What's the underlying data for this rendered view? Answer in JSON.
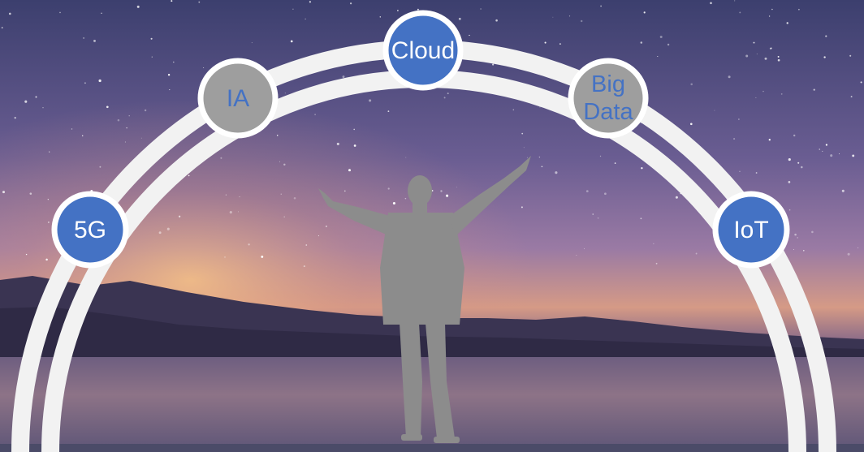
{
  "nodes": [
    {
      "id": "5g",
      "label_lines": [
        "5G"
      ],
      "fill": "#4472c4",
      "text_color": "#ffffff"
    },
    {
      "id": "ia",
      "label_lines": [
        "IA"
      ],
      "fill": "#9e9e9e",
      "text_color": "#4472c4"
    },
    {
      "id": "cloud",
      "label_lines": [
        "Cloud"
      ],
      "fill": "#4472c4",
      "text_color": "#ffffff"
    },
    {
      "id": "bigdata",
      "label_lines": [
        "Big",
        "Data"
      ],
      "fill": "#9e9e9e",
      "text_color": "#4472c4"
    },
    {
      "id": "iot",
      "label_lines": [
        "IoT"
      ],
      "fill": "#4472c4",
      "text_color": "#ffffff"
    }
  ],
  "colors": {
    "arch": "#f2f2f2",
    "node_border": "#ffffff",
    "silhouette": "#8c8c8c"
  }
}
